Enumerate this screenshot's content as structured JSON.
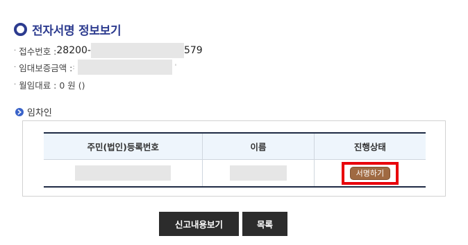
{
  "header": {
    "title": "전자서명 정보보기"
  },
  "info": {
    "receipt_label": "접수번호 : ",
    "receipt_prefix": "28200-",
    "receipt_suffix": "579",
    "deposit_label": "임대보증금액 : ",
    "deposit_visible": "'",
    "monthly_rent_label": "월임대료 : 0 원 ()"
  },
  "lessee_section": {
    "title": "임차인",
    "columns": [
      "주민(법인)등록번호",
      "이름",
      "진행상태"
    ],
    "rows": [
      {
        "status_button": "서명하기"
      }
    ]
  },
  "footer_buttons": {
    "view_report": "신고내용보기",
    "list": "목록"
  }
}
